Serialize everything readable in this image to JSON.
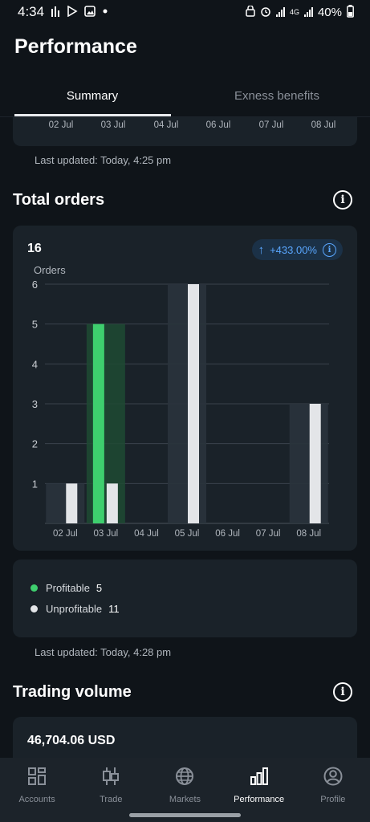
{
  "status_bar": {
    "time": "4:34",
    "battery": "40%",
    "network": "4G"
  },
  "page": {
    "title": "Performance"
  },
  "tabs": [
    {
      "label": "Summary",
      "active": true
    },
    {
      "label": "Exness benefits",
      "active": false
    }
  ],
  "top_card": {
    "axis_labels": [
      "02 Jul",
      "03 Jul",
      "04 Jul",
      "06 Jul",
      "07 Jul",
      "08 Jul"
    ],
    "last_updated": "Last updated: Today, 4:25 pm"
  },
  "total_orders": {
    "title": "Total orders",
    "total": "16",
    "change": "+433.00%",
    "last_updated": "Last updated: Today, 4:28 pm",
    "legend": [
      {
        "label": "Profitable",
        "count": "5",
        "color": "#3ecf6e"
      },
      {
        "label": "Unprofitable",
        "count": "11",
        "color": "#e3e5e8"
      }
    ]
  },
  "chart_data": {
    "type": "bar",
    "ylabel": "Orders",
    "ylim": [
      0,
      6
    ],
    "yticks": [
      1,
      2,
      3,
      4,
      5,
      6
    ],
    "categories": [
      "02 Jul",
      "03 Jul",
      "04 Jul",
      "05 Jul",
      "06 Jul",
      "07 Jul",
      "08 Jul"
    ],
    "series": [
      {
        "name": "Profitable",
        "values": [
          0,
          5,
          0,
          0,
          0,
          0,
          0
        ],
        "color": "#3ecf6e"
      },
      {
        "name": "Unprofitable",
        "values": [
          1,
          1,
          0,
          6,
          0,
          0,
          3
        ],
        "color": "#e3e5e8"
      }
    ],
    "highlighted_category": "03 Jul",
    "grid": true
  },
  "trading_volume": {
    "title": "Trading volume",
    "value": "46,704.06 USD"
  },
  "bottom_nav": [
    {
      "label": "Accounts",
      "icon": "accounts-icon",
      "active": false
    },
    {
      "label": "Trade",
      "icon": "trade-icon",
      "active": false
    },
    {
      "label": "Markets",
      "icon": "globe-icon",
      "active": false
    },
    {
      "label": "Performance",
      "icon": "performance-icon",
      "active": true
    },
    {
      "label": "Profile",
      "icon": "profile-icon",
      "active": false
    }
  ]
}
